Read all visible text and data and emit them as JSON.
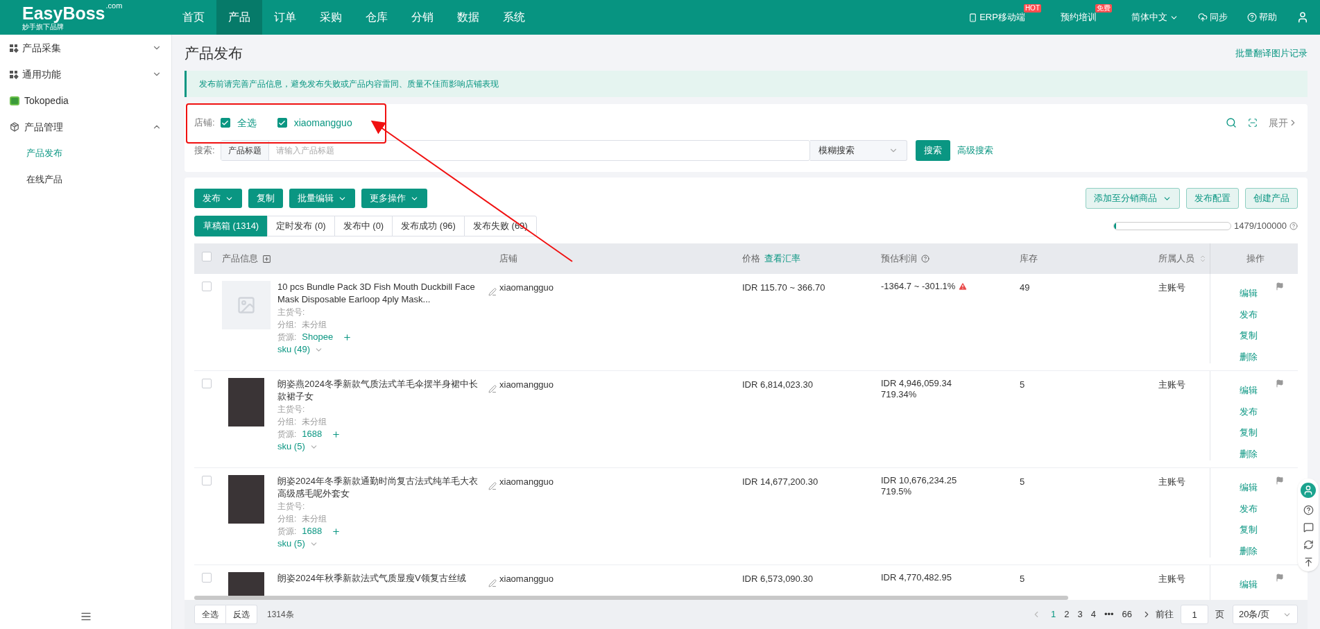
{
  "header": {
    "logo": "EasyBoss",
    "logo_sup": ".com",
    "logo_sub": "妙手旗下品牌",
    "nav": [
      {
        "label": "首页",
        "selected": false
      },
      {
        "label": "产品",
        "selected": true
      },
      {
        "label": "订单",
        "selected": false
      },
      {
        "label": "采购",
        "selected": false
      },
      {
        "label": "仓库",
        "selected": false
      },
      {
        "label": "分销",
        "selected": false
      },
      {
        "label": "数据",
        "selected": false
      },
      {
        "label": "系统",
        "selected": false
      }
    ],
    "tools": [
      {
        "kind": "mobile",
        "label": "ERP移动端",
        "badge": "HOT"
      },
      {
        "kind": "plain",
        "label": "预约培训",
        "badge": "免费"
      },
      {
        "kind": "lang",
        "label": "简体中文"
      },
      {
        "kind": "sync",
        "label": "同步"
      },
      {
        "kind": "help",
        "label": "帮助"
      },
      {
        "kind": "user"
      }
    ]
  },
  "sidebar": {
    "items": [
      {
        "kind": "group",
        "label": "产品采集",
        "expanded": false
      },
      {
        "kind": "group",
        "label": "通用功能",
        "expanded": false
      },
      {
        "kind": "shop",
        "label": "Tokopedia"
      },
      {
        "kind": "box",
        "label": "产品管理",
        "expanded": true,
        "children": [
          {
            "label": "产品发布",
            "selected": true
          },
          {
            "label": "在线产品",
            "selected": false
          }
        ]
      }
    ]
  },
  "page": {
    "title": "产品发布",
    "top_link": "批量翻译图片记录",
    "notice": "发布前请完善产品信息，避免发布失败或产品内容雷同、质量不佳而影响店铺表现"
  },
  "filter": {
    "shop_label": "店铺:",
    "shops": [
      {
        "label": "全选",
        "checked": true
      },
      {
        "label": "xiaomangguo",
        "checked": true
      }
    ],
    "expand": "展开",
    "search_label": "搜索:",
    "search_field": "产品标题",
    "search_placeholder": "请输入产品标题",
    "mode": "模糊搜索",
    "search_button": "搜索",
    "advanced": "高级搜索"
  },
  "toolbar": {
    "left": [
      {
        "label": "发布",
        "dropdown": true
      },
      {
        "label": "复制",
        "dropdown": false
      },
      {
        "label": "批量编辑",
        "dropdown": true
      },
      {
        "label": "更多操作",
        "dropdown": true
      }
    ],
    "right": [
      {
        "label": "添加至分销商品",
        "dropdown": true
      },
      {
        "label": "发布配置",
        "dropdown": false
      },
      {
        "label": "创建产品",
        "dropdown": false
      }
    ]
  },
  "tabs": [
    {
      "label": "草稿箱 (1314)",
      "selected": true
    },
    {
      "label": "定时发布 (0)",
      "selected": false
    },
    {
      "label": "发布中 (0)",
      "selected": false
    },
    {
      "label": "发布成功 (96)",
      "selected": false
    },
    {
      "label": "发布失败 (69)",
      "selected": false
    }
  ],
  "quota": {
    "level": 0.01479,
    "reading": "1479/100000"
  },
  "table": {
    "all_checked": false,
    "columns": [
      {
        "label": "产品信息"
      },
      {
        "label": "店铺"
      },
      {
        "label": "价格",
        "link": "查看汇率"
      },
      {
        "label": "预估利润"
      },
      {
        "label": "库存"
      },
      {
        "label": "所属人员"
      },
      {
        "label": "操作"
      }
    ],
    "rows": [
      {
        "kind": "placeholder",
        "checked": false,
        "title": "10 pcs Bundle Pack 3D Fish Mouth Duckbill Face Mask Disposable Earloop 4ply Mask...",
        "sku_no": "主货号:",
        "group_label": "分组:",
        "group": "未分组",
        "source_label": "货源:",
        "source": "Shopee",
        "sku": "sku (49)",
        "shop": "xiaomangguo",
        "price": "IDR 115.70 ~ 366.70",
        "profit": "-1364.7 ~ -301.1%",
        "profit_pct": "",
        "warning": true,
        "stock": "49",
        "person": "主账号",
        "actions": [
          "编辑",
          "发布",
          "复制",
          "删除"
        ]
      },
      {
        "kind": "photo",
        "checked": false,
        "title": "朗姿燕2024冬季新款气质法式羊毛伞摆半身裙中长款裙子女",
        "sku_no": "主货号:",
        "group_label": "分组:",
        "group": "未分组",
        "source_label": "货源:",
        "source": "1688",
        "sku": "sku (5)",
        "shop": "xiaomangguo",
        "price": "IDR 6,814,023.30",
        "profit": "IDR 4,946,059.34",
        "profit_pct": "719.34%",
        "warning": false,
        "stock": "5",
        "person": "主账号",
        "actions": [
          "编辑",
          "发布",
          "复制",
          "删除"
        ]
      },
      {
        "kind": "photo",
        "checked": false,
        "title": "朗姿2024年冬季新款通勤时尚复古法式纯羊毛大衣高级感毛呢外套女",
        "sku_no": "主货号:",
        "group_label": "分组:",
        "group": "未分组",
        "source_label": "货源:",
        "source": "1688",
        "sku": "sku (5)",
        "shop": "xiaomangguo",
        "price": "IDR 14,677,200.30",
        "profit": "IDR 10,676,234.25",
        "profit_pct": "719.5%",
        "warning": false,
        "stock": "5",
        "person": "主账号",
        "actions": [
          "编辑",
          "发布",
          "复制",
          "删除"
        ]
      },
      {
        "kind": "photo",
        "checked": false,
        "title": "朗姿2024年秋季新款法式气质显瘦V领复古丝绒",
        "shop": "xiaomangguo",
        "price": "IDR 6,573,090.30",
        "profit": "IDR 4,770,482.95",
        "profit_pct": "",
        "warning": false,
        "stock": "5",
        "person": "主账号",
        "actions": [
          "编辑"
        ]
      }
    ]
  },
  "footer": {
    "select_all": "全选",
    "invert": "反选",
    "total": "1314条",
    "pages": [
      {
        "label": "1",
        "selected": true
      },
      {
        "label": "2",
        "selected": false
      },
      {
        "label": "3",
        "selected": false
      },
      {
        "label": "4",
        "selected": false
      },
      {
        "label": "•••",
        "selected": false
      },
      {
        "label": "66",
        "selected": false
      }
    ],
    "goto": "前往",
    "page_value": "1",
    "page_unit": "页",
    "page_size": "20条/页"
  }
}
